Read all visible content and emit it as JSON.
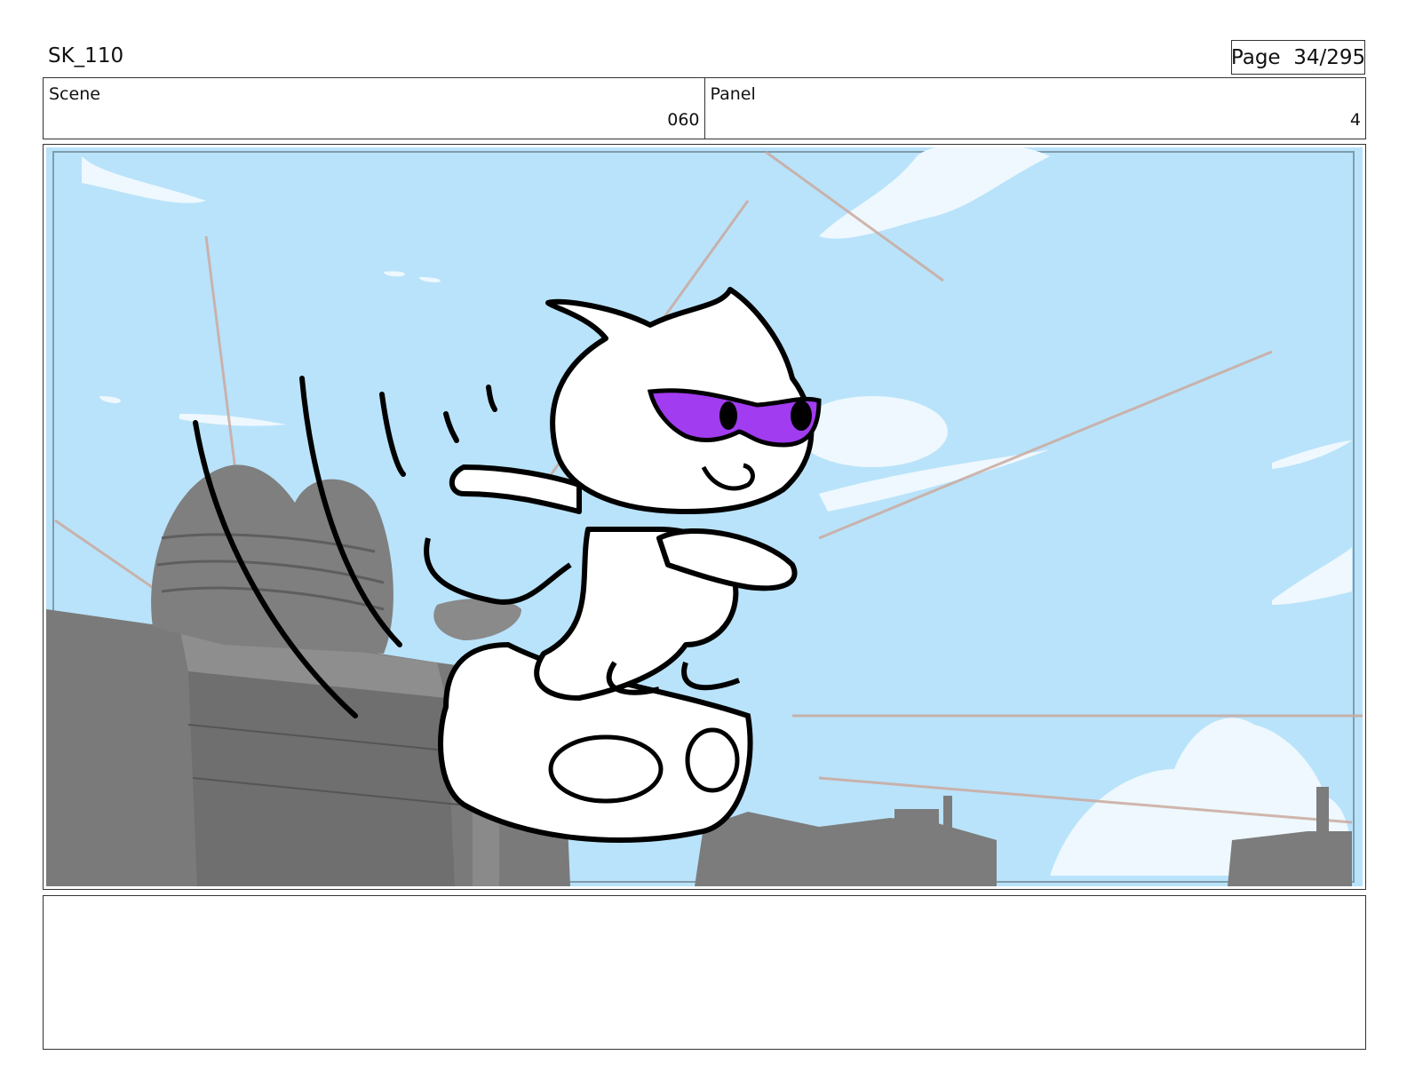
{
  "header": {
    "doc_id": "SK_110",
    "page_label": "Page",
    "page_value": "34/295"
  },
  "scene": {
    "label": "Scene",
    "value": "060"
  },
  "panel": {
    "label": "Panel",
    "value": "4"
  },
  "colors": {
    "sky": "#b9e3fa",
    "cloud": "#eef8fe",
    "building": "#7a7a7a",
    "mask": "#a13cf0",
    "ink": "#000000"
  },
  "notes": {
    "text": ""
  }
}
